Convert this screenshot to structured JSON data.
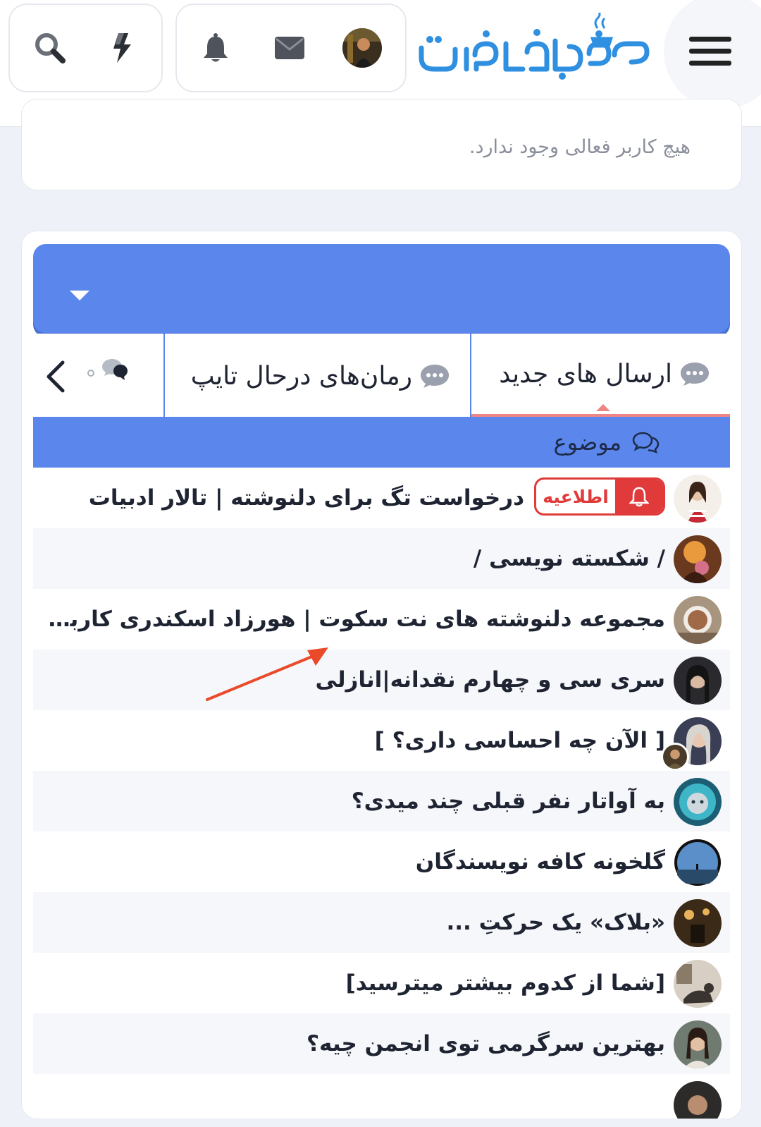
{
  "header": {
    "logo_text": "کافه نویسندگان",
    "icons": [
      "search-icon",
      "lightning-icon",
      "bell-icon",
      "envelope-icon",
      "user-avatar",
      "hamburger-menu-icon"
    ]
  },
  "online": {
    "empty_text": "هیچ کاربر فعالی وجود ندارد."
  },
  "tabs": {
    "new_posts": "ارسال های جدید",
    "typing_novels": "رمان‌های درحال تایپ"
  },
  "subject_label": "موضوع",
  "threads": [
    {
      "title": "درخواست تگ برای دلنوشته | تالار ادبیات",
      "badge": "اطلاعیه"
    },
    {
      "title": "/ شکسته نویسی /"
    },
    {
      "title": "مجموعه دلنوشته های نت سکوت | هورزاد اسکندری کاربر انجمن کافه نویسندگان"
    },
    {
      "title": "سری سی و چهارم نقدانه|انازلی"
    },
    {
      "title": "[ الآن چه احساسی داری؟ ]"
    },
    {
      "title": "به آواتار نفر قبلی چند میدی؟"
    },
    {
      "title": "گلخونه کافه نویسندگان"
    },
    {
      "title": "«بلاک» یک حرکتِ ..."
    },
    {
      "title": "[شما از کدوم بیشتر میترسید]"
    },
    {
      "title": "بهترین سرگرمی توی انجمن چیه؟"
    }
  ],
  "colors": {
    "accent_blue": "#5b87ec",
    "active_tab_underline": "#f08585",
    "badge_red": "#e03a3a",
    "logo_blue": "#2f8fe0"
  }
}
